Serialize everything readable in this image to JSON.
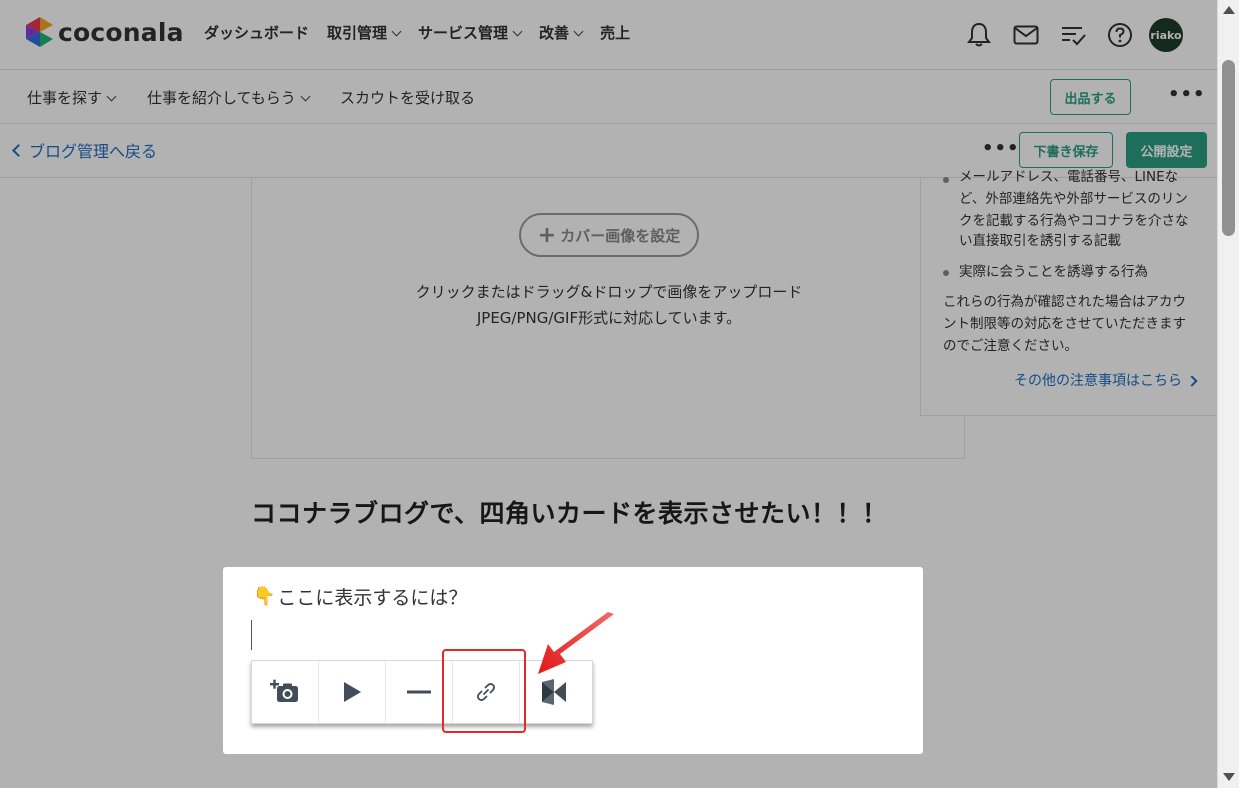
{
  "brand": {
    "name": "coconala"
  },
  "header": {
    "nav": [
      {
        "label": "ダッシュボード",
        "dropdown": false
      },
      {
        "label": "取引管理",
        "dropdown": true
      },
      {
        "label": "サービス管理",
        "dropdown": true
      },
      {
        "label": "改善",
        "dropdown": true
      },
      {
        "label": "売上",
        "dropdown": false
      }
    ],
    "icons": [
      "bell-icon",
      "mail-icon",
      "task-list-icon",
      "help-icon"
    ],
    "user": {
      "avatar_text": "riako"
    }
  },
  "subnav": {
    "items": [
      {
        "label": "仕事を探す",
        "dropdown": true
      },
      {
        "label": "仕事を紹介してもらう",
        "dropdown": true
      },
      {
        "label": "スカウトを受け取る",
        "dropdown": false
      }
    ],
    "sell_button": "出品する",
    "more": "•••"
  },
  "editbar": {
    "back_label": "ブログ管理へ戻る",
    "more": "•••",
    "save_draft": "下書き保存",
    "publish_settings": "公開設定"
  },
  "cover": {
    "button_label": "カバー画像を設定",
    "hint_line1": "クリックまたはドラッグ&ドロップで画像をアップロード",
    "hint_line2": "JPEG/PNG/GIF形式に対応しています。"
  },
  "notice": {
    "line_cut": "メールアドレス、電話番号、LINEな",
    "line_a": "ど、外部連絡先や外部サービスのリン",
    "line_b": "クを記載する行為やココナラを介さな",
    "line_c": "い直接取引を誘引する記載",
    "line_d": "実際に会うことを誘導する行為",
    "line_e": "これらの行為が確認された場合はアカウ",
    "line_f": "ント制限等の対応をさせていただきます",
    "line_g": "のでご注意ください。",
    "link": "その他の注意事項はこちら"
  },
  "article": {
    "title": "ココナラブログで、四角いカードを表示させたい！！！",
    "paragraph": "ここに表示するには？",
    "emoji": "👇"
  },
  "toolbar": {
    "tools": [
      "add-image-icon",
      "video-play-icon",
      "divider-line-icon",
      "link-icon",
      "embed-card-icon"
    ],
    "highlighted": "link-icon"
  },
  "colors": {
    "accent": "#2b9e85",
    "link": "#1f6dc2",
    "highlight": "#e32a2a"
  }
}
